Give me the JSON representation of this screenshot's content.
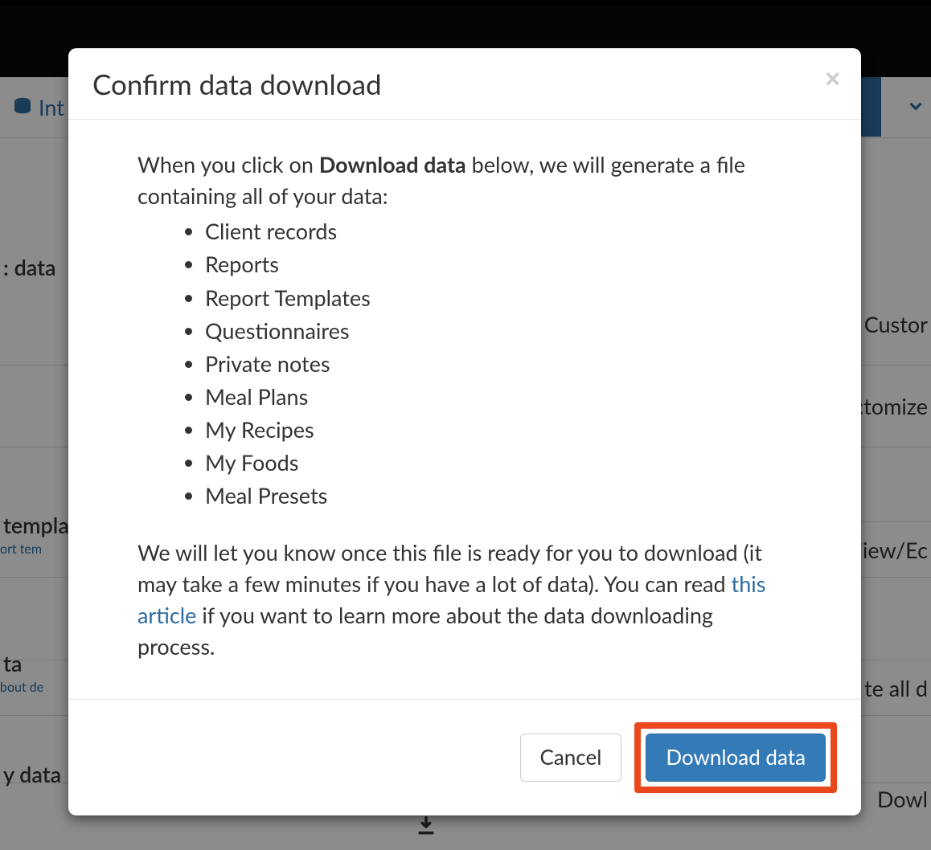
{
  "nav": {
    "item_label": "Int"
  },
  "background": {
    "section1_label": ": data",
    "row1_right": "Custor",
    "row2_right": ":tomize",
    "section2_label": "templa",
    "section2_link": "ort tem",
    "row3_right": "'iew/Ec",
    "section3_label": "ta",
    "section3_link": "bout de",
    "row4_right": "te all d",
    "section4_label": "y data",
    "row5_right": "Dowl"
  },
  "modal": {
    "title": "Confirm data download",
    "intro_before": "When you click on ",
    "intro_bold": "Download data",
    "intro_after": " below, we will generate a file containing all of your data:",
    "items": [
      "Client records",
      "Reports",
      "Report Templates",
      "Questionnaires",
      "Private notes",
      "Meal Plans",
      "My Recipes",
      "My Foods",
      "Meal Presets"
    ],
    "outro_before": "We will let you know once this file is ready for you to download (it may take a few minutes if you have a lot of data). You can read ",
    "outro_link": "this article",
    "outro_after": " if you want to learn more about the data downloading process.",
    "cancel_label": "Cancel",
    "download_label": "Download data"
  }
}
